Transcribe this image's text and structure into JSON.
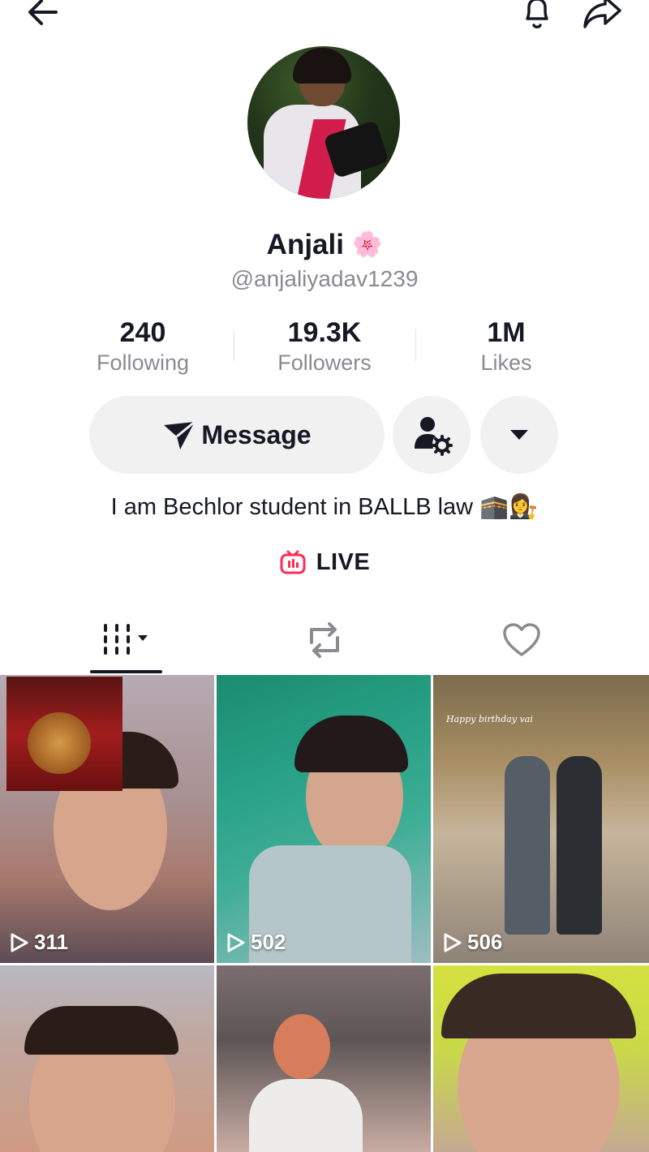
{
  "header": {
    "back_icon": "arrow-left-icon",
    "notification_icon": "bell-icon",
    "share_icon": "share-arrow-icon"
  },
  "profile": {
    "display_name": "Anjali",
    "name_emoji": "🌸",
    "username": "@anjaliyadav1239",
    "bio": "I am Bechlor student in BALLB law 🕋👩‍⚖️",
    "live_label": "LIVE",
    "live_icon": "tv-live-icon"
  },
  "stats": [
    {
      "value": "240",
      "label": "Following"
    },
    {
      "value": "19.3K",
      "label": "Followers"
    },
    {
      "value": "1M",
      "label": "Likes"
    }
  ],
  "actions": {
    "message_label": "Message",
    "message_icon": "send-plane-icon",
    "friend_settings_icon": "person-gear-icon",
    "more_icon": "caret-down-icon"
  },
  "tabs": [
    {
      "name": "videos",
      "icon": "grid-icon",
      "active": true
    },
    {
      "name": "reposts",
      "icon": "repost-icon",
      "active": false
    },
    {
      "name": "liked",
      "icon": "heart-outline-icon",
      "active": false
    }
  ],
  "videos": [
    {
      "views": "311"
    },
    {
      "views": "502"
    },
    {
      "views": "506",
      "caption": "Happy birthday vai"
    },
    {
      "views": ""
    },
    {
      "views": ""
    },
    {
      "views": ""
    }
  ],
  "colors": {
    "text_primary": "#161823",
    "text_secondary": "#8a8b91",
    "button_bg": "#f1f1f2",
    "live_accent": "#fe2c55"
  }
}
